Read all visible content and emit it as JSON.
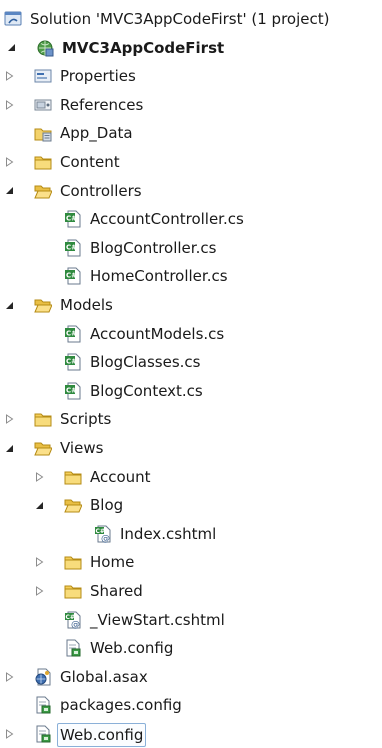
{
  "tree": [
    {
      "label": "Solution 'MVC3AppCodeFirst' (1 project)",
      "icon": "solution-icon",
      "depth": 0,
      "state": "none"
    },
    {
      "label": "MVC3AppCodeFirst",
      "icon": "web-project-icon",
      "depth": 0,
      "state": "expanded",
      "bold": true
    },
    {
      "label": "Properties",
      "icon": "properties-icon",
      "depth": 1,
      "state": "collapsed"
    },
    {
      "label": "References",
      "icon": "references-icon",
      "depth": 1,
      "state": "collapsed"
    },
    {
      "label": "App_Data",
      "icon": "app-data-folder-icon",
      "depth": 1,
      "state": "none"
    },
    {
      "label": "Content",
      "icon": "folder-icon",
      "depth": 1,
      "state": "collapsed"
    },
    {
      "label": "Controllers",
      "icon": "folder-open-icon",
      "depth": 1,
      "state": "expanded"
    },
    {
      "label": "AccountController.cs",
      "icon": "csharp-file-icon",
      "depth": 2,
      "state": "none"
    },
    {
      "label": "BlogController.cs",
      "icon": "csharp-file-icon",
      "depth": 2,
      "state": "none"
    },
    {
      "label": "HomeController.cs",
      "icon": "csharp-file-icon",
      "depth": 2,
      "state": "none"
    },
    {
      "label": "Models",
      "icon": "folder-open-icon",
      "depth": 1,
      "state": "expanded"
    },
    {
      "label": "AccountModels.cs",
      "icon": "csharp-file-icon",
      "depth": 2,
      "state": "none"
    },
    {
      "label": "BlogClasses.cs",
      "icon": "csharp-file-icon",
      "depth": 2,
      "state": "none"
    },
    {
      "label": "BlogContext.cs",
      "icon": "csharp-file-icon",
      "depth": 2,
      "state": "none"
    },
    {
      "label": "Scripts",
      "icon": "folder-icon",
      "depth": 1,
      "state": "collapsed"
    },
    {
      "label": "Views",
      "icon": "folder-open-icon",
      "depth": 1,
      "state": "expanded"
    },
    {
      "label": "Account",
      "icon": "folder-icon",
      "depth": 2,
      "state": "collapsed"
    },
    {
      "label": "Blog",
      "icon": "folder-open-icon",
      "depth": 2,
      "state": "expanded"
    },
    {
      "label": "Index.cshtml",
      "icon": "cshtml-file-icon",
      "depth": 3,
      "state": "none"
    },
    {
      "label": "Home",
      "icon": "folder-icon",
      "depth": 2,
      "state": "collapsed"
    },
    {
      "label": "Shared",
      "icon": "folder-icon",
      "depth": 2,
      "state": "collapsed"
    },
    {
      "label": "_ViewStart.cshtml",
      "icon": "cshtml-file-icon",
      "depth": 2,
      "state": "none"
    },
    {
      "label": "Web.config",
      "icon": "config-file-icon",
      "depth": 2,
      "state": "none"
    },
    {
      "label": "Global.asax",
      "icon": "global-asax-icon",
      "depth": 1,
      "state": "collapsed"
    },
    {
      "label": "packages.config",
      "icon": "config-file-icon",
      "depth": 1,
      "state": "none"
    },
    {
      "label": "Web.config",
      "icon": "config-file-icon",
      "depth": 1,
      "state": "collapsed",
      "selected": true
    }
  ]
}
